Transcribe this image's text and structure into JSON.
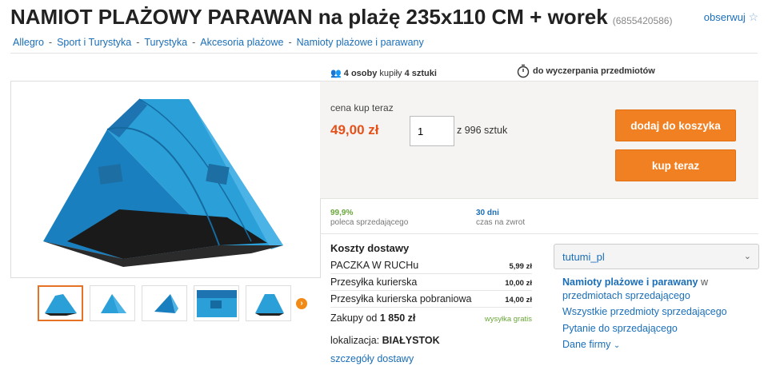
{
  "title": "NAMIOT PLAŻOWY PARAWAN na plażę 235x110 CM + worek",
  "product_id": "(6855420586)",
  "watch_label": "obserwuj",
  "breadcrumbs": [
    "Allegro",
    "Sport i Turystyka",
    "Turystyka",
    "Akcesoria plażowe",
    "Namioty plażowe i parawany"
  ],
  "stats": {
    "buyers": "4 osoby",
    "bought_word": "kupiły",
    "pieces": "4 sztuki",
    "until": "do wyczerpania przedmiotów"
  },
  "buy": {
    "price_label": "cena kup teraz",
    "price": "49,00 zł",
    "quantity": "1",
    "stock": "z 996 sztuk",
    "add_to_cart": "dodaj do koszyka",
    "buy_now": "kup teraz"
  },
  "rating": {
    "value": "99,9%",
    "label": "poleca sprzedającego"
  },
  "returns": {
    "value": "30 dni",
    "label": "czas na zwrot"
  },
  "shipping": {
    "heading": "Koszty dostawy",
    "rows": [
      {
        "name": "PACZKA W RUCHu",
        "price": "5,99 zł"
      },
      {
        "name": "Przesyłka kurierska",
        "price": "10,00 zł"
      },
      {
        "name": "Przesyłka kurierska pobraniowa",
        "price": "14,00 zł"
      }
    ],
    "free_prefix": "Zakupy od",
    "free_amount": "1 850 zł",
    "free_label": "wysyłka gratis",
    "location_label": "lokalizacja:",
    "location": "BIAŁYSTOK",
    "details_link": "szczegóły dostawy"
  },
  "seller": {
    "name": "tutumi_pl",
    "category_link": "Namioty plażowe i parawany",
    "category_suffix1": "w",
    "category_suffix2": "przedmiotach sprzedającego",
    "all_items": "Wszystkie przedmioty sprzedającego",
    "ask": "Pytanie do sprzedającego",
    "company": "Dane firmy"
  },
  "colors": {
    "accent_orange": "#f08022",
    "link_blue": "#1a6eb8",
    "price_red": "#e5511b",
    "tent_blue": "#2a9fd8"
  }
}
